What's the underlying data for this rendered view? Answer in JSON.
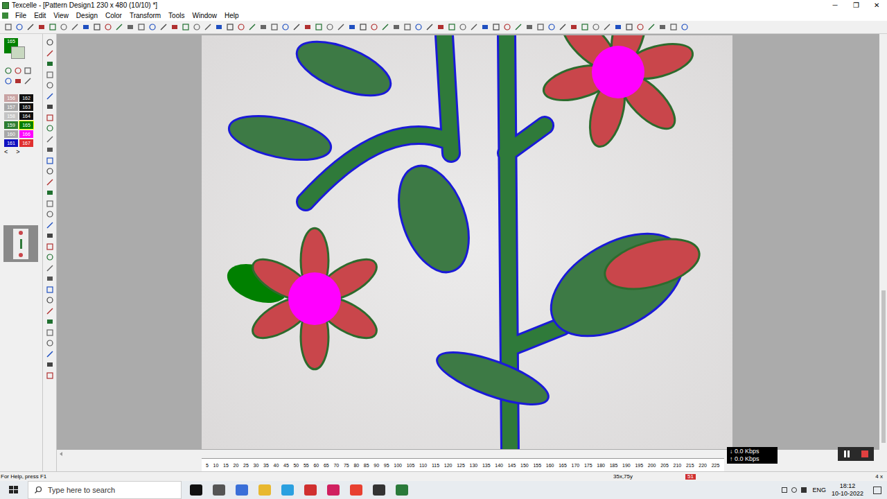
{
  "window": {
    "title": "Texcelle - [Pattern Design1 230 x 480 (10/10) *]",
    "controls": [
      "─",
      "❐",
      "✕"
    ]
  },
  "menu": [
    "File",
    "Edit",
    "View",
    "Design",
    "Color",
    "Transform",
    "Tools",
    "Window",
    "Help"
  ],
  "palette": {
    "current": "165",
    "current_color": "#008000",
    "swatches": [
      {
        "label": "156",
        "color": "#c9a3a3",
        "selected": false
      },
      {
        "label": "162",
        "color": "#111111",
        "selected": false
      },
      {
        "label": "157",
        "color": "#a8a8a8",
        "selected": false
      },
      {
        "label": "163",
        "color": "#111111",
        "selected": false
      },
      {
        "label": "158",
        "color": "#c4c4c4",
        "selected": false
      },
      {
        "label": "164",
        "color": "#111111",
        "selected": false
      },
      {
        "label": "159",
        "color": "#2e7d32",
        "selected": false
      },
      {
        "label": "165",
        "color": "#008000",
        "selected": true
      },
      {
        "label": "160",
        "color": "#a8a8a8",
        "selected": false
      },
      {
        "label": "166",
        "color": "#ff00ff",
        "selected": false
      },
      {
        "label": "161",
        "color": "#1010c0",
        "selected": false
      },
      {
        "label": "167",
        "color": "#e03030",
        "selected": false
      }
    ],
    "nav": [
      "<",
      ">"
    ]
  },
  "ruler": [
    "5",
    "10",
    "15",
    "20",
    "25",
    "30",
    "35",
    "40",
    "45",
    "50",
    "55",
    "60",
    "65",
    "70",
    "75",
    "80",
    "85",
    "90",
    "95",
    "100",
    "105",
    "110",
    "115",
    "120",
    "125",
    "130",
    "135",
    "140",
    "145",
    "150",
    "155",
    "160",
    "165",
    "170",
    "175",
    "180",
    "185",
    "190",
    "195",
    "200",
    "205",
    "210",
    "215",
    "220",
    "225"
  ],
  "network": {
    "down": "↓ 0.0 Kbps",
    "up": "↑ 0.0 Kbps"
  },
  "status_bar": {
    "help": "For Help, press F1",
    "position": "35x,75y",
    "count": "51",
    "zoom": "4 x"
  },
  "taskbar": {
    "search_placeholder": "Type here to search",
    "language": "ENG",
    "time": "18:12",
    "date": "10-10-2022"
  }
}
